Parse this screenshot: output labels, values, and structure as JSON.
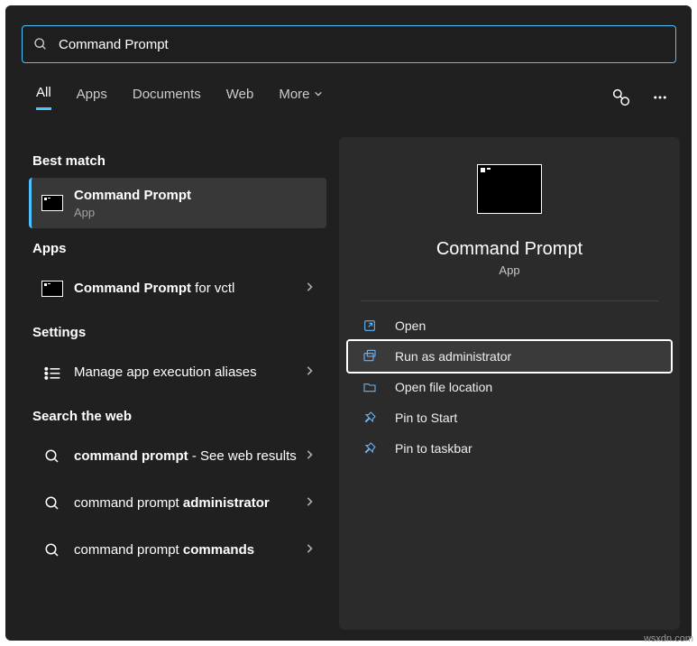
{
  "search": {
    "query": "Command Prompt"
  },
  "tabs": {
    "items": [
      "All",
      "Apps",
      "Documents",
      "Web",
      "More"
    ],
    "active": 0
  },
  "sections": {
    "best_match": "Best match",
    "apps": "Apps",
    "settings": "Settings",
    "search_web": "Search the web"
  },
  "results": {
    "best_match": {
      "title_bold": "Command Prompt",
      "title_rest": "",
      "sub": "App"
    },
    "apps": {
      "title_bold": "Command Prompt",
      "title_rest": " for vctl"
    },
    "settings": {
      "title": "Manage app execution aliases"
    },
    "web": [
      {
        "title_bold": "command prompt",
        "title_rest": " - See web results"
      },
      {
        "title_bold_pre": "command prompt ",
        "title_bold": "administrator"
      },
      {
        "title_bold_pre": "command prompt ",
        "title_bold": "commands"
      }
    ]
  },
  "preview": {
    "title": "Command Prompt",
    "sub": "App",
    "actions": {
      "open": "Open",
      "run_admin": "Run as administrator",
      "open_loc": "Open file location",
      "pin_start": "Pin to Start",
      "pin_taskbar": "Pin to taskbar"
    }
  },
  "watermark": "wsxdn.com"
}
